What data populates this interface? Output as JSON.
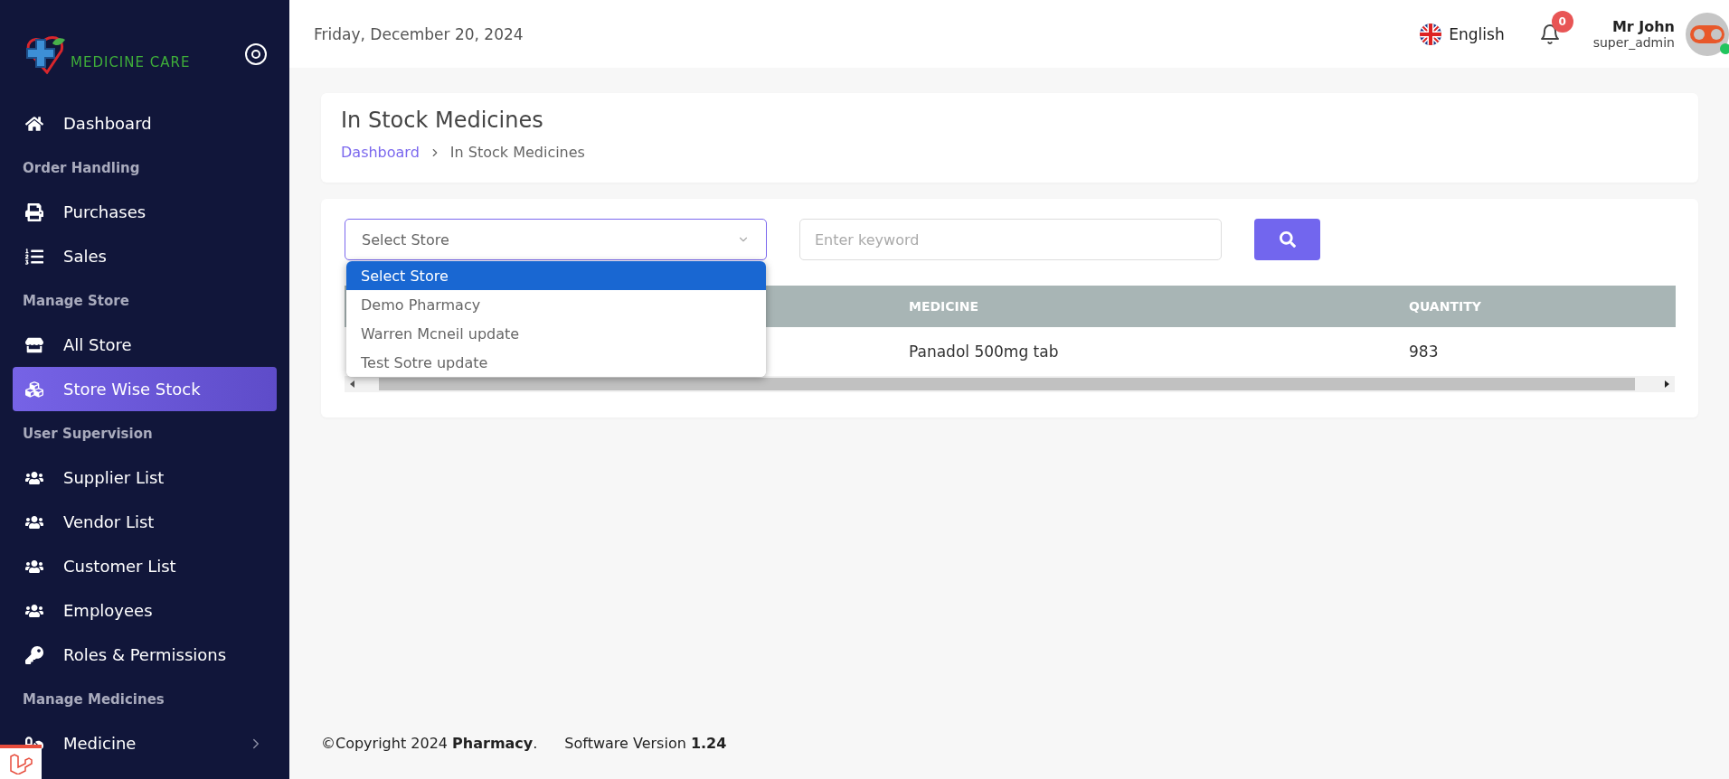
{
  "brand": {
    "name": "MEDICINE CARE"
  },
  "sidebar": {
    "items": [
      {
        "kind": "item",
        "label": "Dashboard",
        "selected": false
      },
      {
        "kind": "heading",
        "label": "Order Handling"
      },
      {
        "kind": "item",
        "label": "Purchases",
        "selected": false
      },
      {
        "kind": "item",
        "label": "Sales",
        "selected": false
      },
      {
        "kind": "heading",
        "label": "Manage Store"
      },
      {
        "kind": "item",
        "label": "All Store",
        "selected": false
      },
      {
        "kind": "item",
        "label": "Store Wise Stock",
        "selected": true
      },
      {
        "kind": "heading",
        "label": "User Supervision"
      },
      {
        "kind": "item",
        "label": "Supplier List",
        "selected": false
      },
      {
        "kind": "item",
        "label": "Vendor List",
        "selected": false
      },
      {
        "kind": "item",
        "label": "Customer List",
        "selected": false
      },
      {
        "kind": "item",
        "label": "Employees",
        "selected": false
      },
      {
        "kind": "item",
        "label": "Roles & Permissions",
        "selected": false
      },
      {
        "kind": "heading",
        "label": "Manage Medicines"
      },
      {
        "kind": "item",
        "label": "Medicine",
        "selected": false,
        "expanded": false
      }
    ]
  },
  "header": {
    "date": "Friday, December 20, 2024",
    "language": "English",
    "notifications": "0",
    "user": {
      "name": "Mr John",
      "role": "super_admin",
      "online": true
    }
  },
  "page": {
    "title": "In Stock Medicines",
    "breadcrumb": [
      {
        "label": "Dashboard",
        "link": true
      },
      {
        "label": "In Stock Medicines",
        "link": false
      }
    ]
  },
  "filters": {
    "store_select": {
      "value": "Select Store",
      "open": true,
      "options": [
        {
          "label": "Select Store",
          "selected": true
        },
        {
          "label": "Demo Pharmacy",
          "selected": false
        },
        {
          "label": "Warren Mcneil update",
          "selected": false
        },
        {
          "label": "Test Sotre update",
          "selected": false
        }
      ]
    },
    "keyword": {
      "placeholder": "Enter keyword"
    }
  },
  "table": {
    "columns": [
      "MEDICINE",
      "QUANTITY"
    ],
    "rows": [
      [
        "Panadol 500mg tab",
        "983"
      ]
    ]
  },
  "footer": {
    "copyright": "©Copyright 2024 **Pharmacy**.",
    "version": "Software Version **1.24**"
  }
}
